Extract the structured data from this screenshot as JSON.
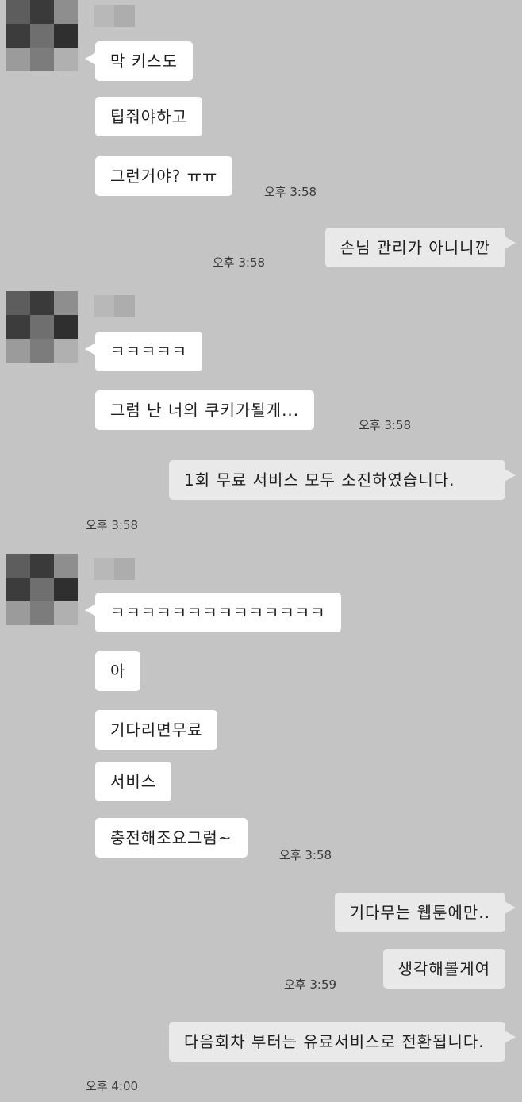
{
  "chat": {
    "groups": [
      {
        "messages": [
          {
            "text": "막 키스도"
          },
          {
            "text": "팁줘야하고"
          },
          {
            "text": "그런거야? ㅠㅠ",
            "time": "오후 3:58"
          }
        ]
      },
      {
        "messages": [
          {
            "text": "손님 관리가 아니니깐",
            "time": "오후 3:58"
          }
        ]
      },
      {
        "messages": [
          {
            "text": "ㅋㅋㅋㅋㅋ"
          },
          {
            "text": "그럼 난 너의 쿠키가될게...",
            "time": "오후 3:58"
          }
        ]
      },
      {
        "messages": [
          {
            "text": "1회 무료 서비스 모두 소진하였습니다.",
            "time": "오후 3:58"
          }
        ]
      },
      {
        "messages": [
          {
            "text": "ㅋㅋㅋㅋㅋㅋㅋㅋㅋㅋㅋㅋㅋㅋ"
          },
          {
            "text": "아"
          },
          {
            "text": "기다리면무료"
          },
          {
            "text": "서비스"
          },
          {
            "text": "충전해조요그럼~",
            "time": "오후 3:58"
          }
        ]
      },
      {
        "messages": [
          {
            "text": "기다무는 웹툰에만.."
          },
          {
            "text": "생각해볼게여",
            "time": "오후 3:59"
          }
        ]
      },
      {
        "messages": [
          {
            "text": "다음회차 부터는 유료서비스로 전환됩니다.",
            "time": "오후 4:00"
          }
        ]
      }
    ]
  },
  "colors": {
    "background": "#c4c4c4",
    "incoming_bubble": "#ffffff",
    "outgoing_bubble": "#e9e9e9"
  }
}
